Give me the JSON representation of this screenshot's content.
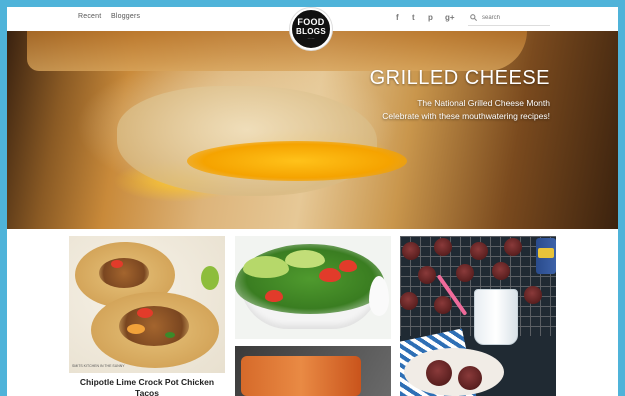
{
  "header": {
    "nav": [
      "Recent",
      "Bloggers"
    ],
    "logo": {
      "line1": "FOOD",
      "line2": "BLOGS",
      "line3": "— —"
    },
    "social": [
      {
        "icon": "facebook-icon",
        "glyph": "f"
      },
      {
        "icon": "twitter-icon",
        "glyph": "t"
      },
      {
        "icon": "pinterest-icon",
        "glyph": "p"
      },
      {
        "icon": "google-plus-icon",
        "glyph": "g+"
      }
    ],
    "search_placeholder": "search"
  },
  "hero": {
    "title": "GRILLED CHEESE",
    "subtitle": "The National Grilled Cheese Month Celebrate with these mouthwatering recipes!"
  },
  "cards": [
    {
      "title": "Chipotle Lime Crock Pot Chicken Tacos",
      "credit": "SMITS KITCHEN IN THE SUNNY"
    },
    {
      "title": ""
    },
    {
      "title": ""
    }
  ],
  "colors": {
    "frame": "#4fb3d9",
    "logo_bg": "#111111"
  }
}
